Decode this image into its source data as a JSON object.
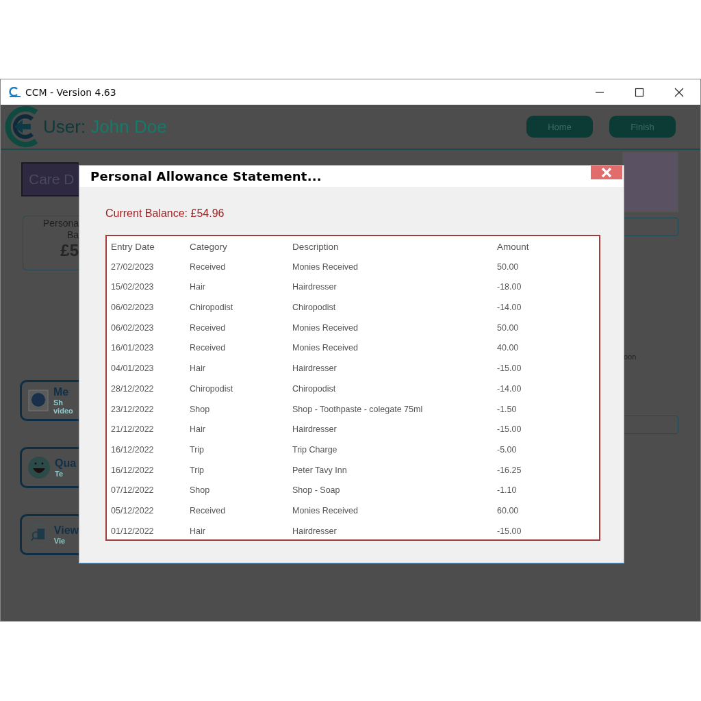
{
  "window": {
    "title": "CCM - Version 4.63"
  },
  "header": {
    "user_label": "User:",
    "user_name": "John Doe",
    "buttons": [
      "Home",
      "Finish"
    ]
  },
  "background": {
    "section_title": "Care D",
    "balance_card": {
      "lines": [
        "Persona",
        "Ba"
      ],
      "amount": "£5"
    },
    "tiles": [
      {
        "kind": "media",
        "title": "Me",
        "lines": [
          "Sh",
          "video"
        ]
      },
      {
        "kind": "smiley",
        "title": "Qua",
        "lines": [
          "Te"
        ]
      },
      {
        "kind": "view",
        "title": "View",
        "lines": [
          "Vie"
        ]
      }
    ],
    "side_text": "oon"
  },
  "dialog": {
    "title": "Personal Allowance Statement...",
    "balance": "Current Balance: £54.96",
    "table": {
      "columns": [
        "Entry Date",
        "Category",
        "Description",
        "Amount"
      ],
      "rows": [
        [
          "27/02/2023",
          "Received",
          "Monies Received",
          "50.00"
        ],
        [
          "15/02/2023",
          "Hair",
          "Hairdresser",
          "-18.00"
        ],
        [
          "06/02/2023",
          "Chiropodist",
          "Chiropodist",
          "-14.00"
        ],
        [
          "06/02/2023",
          "Received",
          "Monies Received",
          "50.00"
        ],
        [
          "16/01/2023",
          "Received",
          "Monies Received",
          "40.00"
        ],
        [
          "04/01/2023",
          "Hair",
          "Hairdresser",
          "-15.00"
        ],
        [
          "28/12/2022",
          "Chiropodist",
          "Chiropodist",
          "-14.00"
        ],
        [
          "23/12/2022",
          "Shop",
          "Shop - Toothpaste - colegate 75ml",
          "-1.50"
        ],
        [
          "21/12/2022",
          "Hair",
          "Hairdresser",
          "-15.00"
        ],
        [
          "16/12/2022",
          "Trip",
          "Trip Charge",
          "-5.00"
        ],
        [
          "16/12/2022",
          "Trip",
          "Peter Tavy Inn",
          "-16.25"
        ],
        [
          "07/12/2022",
          "Shop",
          "Shop - Soap",
          "-1.10"
        ],
        [
          "05/12/2022",
          "Received",
          "Monies Received",
          "60.00"
        ],
        [
          "01/12/2022",
          "Hair",
          "Hairdresser",
          "-15.00"
        ]
      ]
    }
  }
}
